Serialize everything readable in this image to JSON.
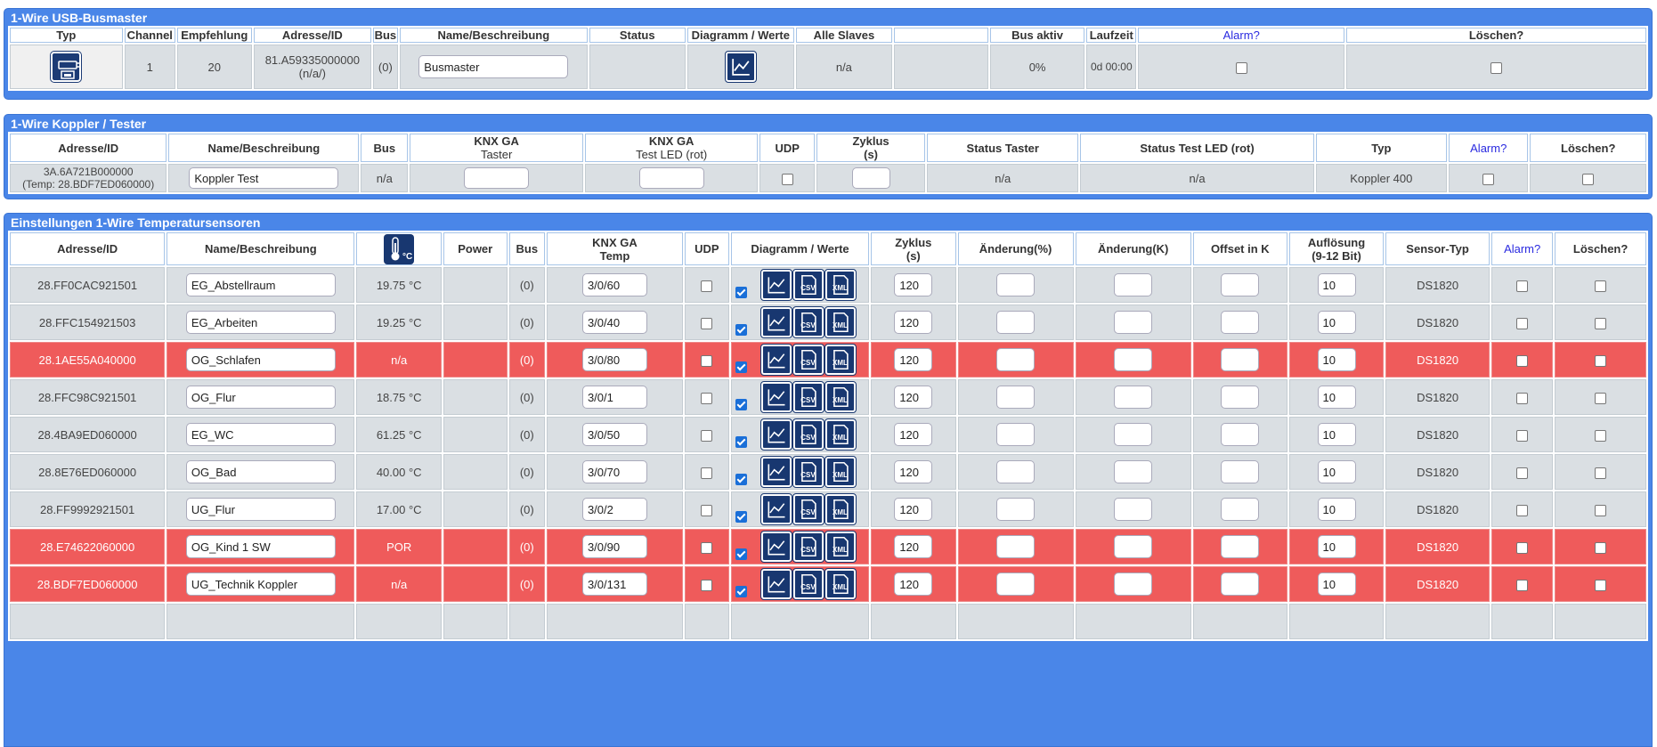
{
  "busmaster": {
    "title": "1-Wire USB-Busmaster",
    "headers": [
      "Typ",
      "Channel",
      "Empfehlung",
      "Adresse/ID",
      "Bus",
      "Name/Beschreibung",
      "Status",
      "Diagramm / Werte",
      "Alle Slaves",
      "",
      "Bus aktiv",
      "Laufzeit",
      "Alarm?",
      "Löschen?"
    ],
    "row": {
      "channel": "1",
      "empfehlung": "20",
      "address": "81.A59335000000",
      "address_sub": "(n/a/)",
      "bus": "(0)",
      "name": "Busmaster",
      "status": "",
      "slaves": "n/a",
      "blank": "",
      "bus_active": "0%",
      "runtime": "0d 00:00"
    }
  },
  "koppler": {
    "title": "1-Wire Koppler / Tester",
    "headers": {
      "address": "Adresse/ID",
      "name": "Name/Beschreibung",
      "bus": "Bus",
      "ga_taster_1": "KNX GA",
      "ga_taster_2": "Taster",
      "ga_led_1": "KNX GA",
      "ga_led_2": "Test LED (rot)",
      "udp": "UDP",
      "zyklus_1": "Zyklus",
      "zyklus_2": "(s)",
      "status_taster": "Status Taster",
      "status_led": "Status Test LED (rot)",
      "typ": "Typ",
      "alarm": "Alarm?",
      "delete": "Löschen?"
    },
    "row": {
      "address": "3A.6A721B000000",
      "address_sub": "(Temp: 28.BDF7ED060000)",
      "name": "Koppler Test",
      "bus": "n/a",
      "ga_taster": "",
      "ga_led": "",
      "zyklus": "",
      "status_taster": "n/a",
      "status_led": "n/a",
      "typ": "Koppler 400"
    }
  },
  "temp": {
    "title": "Einstellungen 1-Wire Temperatursensoren",
    "headers": {
      "address": "Adresse/ID",
      "name": "Name/Beschreibung",
      "power": "Power",
      "bus": "Bus",
      "ga_1": "KNX GA",
      "ga_2": "Temp",
      "udp": "UDP",
      "diag": "Diagramm / Werte",
      "zyklus_1": "Zyklus",
      "zyklus_2": "(s)",
      "change_pct": "Änderung(%)",
      "change_k": "Änderung(K)",
      "offset": "Offset in K",
      "res_1": "Auflösung",
      "res_2": "(9-12 Bit)",
      "sensor": "Sensor-Typ",
      "alarm": "Alarm?",
      "delete": "Löschen?",
      "therm_unit": "°C"
    },
    "icons": {
      "csv": "CSV",
      "xml": "XML"
    },
    "rows": [
      {
        "address": "28.FF0CAC921501",
        "name": "EG_Abstellraum",
        "value": "19.75 °C",
        "bus": "(0)",
        "ga": "3/0/60",
        "zyklus": "120",
        "res": "10",
        "sensor": "DS1820",
        "alert": false
      },
      {
        "address": "28.FFC154921503",
        "name": "EG_Arbeiten",
        "value": "19.25 °C",
        "bus": "(0)",
        "ga": "3/0/40",
        "zyklus": "120",
        "res": "10",
        "sensor": "DS1820",
        "alert": false
      },
      {
        "address": "28.1AE55A040000",
        "name": "OG_Schlafen",
        "value": "n/a",
        "bus": "(0)",
        "ga": "3/0/80",
        "zyklus": "120",
        "res": "10",
        "sensor": "DS1820",
        "alert": true
      },
      {
        "address": "28.FFC98C921501",
        "name": "OG_Flur",
        "value": "18.75 °C",
        "bus": "(0)",
        "ga": "3/0/1",
        "zyklus": "120",
        "res": "10",
        "sensor": "DS1820",
        "alert": false
      },
      {
        "address": "28.4BA9ED060000",
        "name": "EG_WC",
        "value": "61.25 °C",
        "bus": "(0)",
        "ga": "3/0/50",
        "zyklus": "120",
        "res": "10",
        "sensor": "DS1820",
        "alert": false
      },
      {
        "address": "28.8E76ED060000",
        "name": "OG_Bad",
        "value": "40.00 °C",
        "bus": "(0)",
        "ga": "3/0/70",
        "zyklus": "120",
        "res": "10",
        "sensor": "DS1820",
        "alert": false
      },
      {
        "address": "28.FF9992921501",
        "name": "UG_Flur",
        "value": "17.00 °C",
        "bus": "(0)",
        "ga": "3/0/2",
        "zyklus": "120",
        "res": "10",
        "sensor": "DS1820",
        "alert": false
      },
      {
        "address": "28.E74622060000",
        "name": "OG_Kind 1 SW",
        "value": "POR",
        "bus": "(0)",
        "ga": "3/0/90",
        "zyklus": "120",
        "res": "10",
        "sensor": "DS1820",
        "alert": true
      },
      {
        "address": "28.BDF7ED060000",
        "name": "UG_Technik Koppler",
        "value": "n/a",
        "bus": "(0)",
        "ga": "3/0/131",
        "zyklus": "120",
        "res": "10",
        "sensor": "DS1820",
        "alert": true
      }
    ]
  },
  "colors": {
    "section": "#4a86e8",
    "row": "#dadfe3",
    "alert": "#ef5b5b",
    "icon": "#183770"
  }
}
